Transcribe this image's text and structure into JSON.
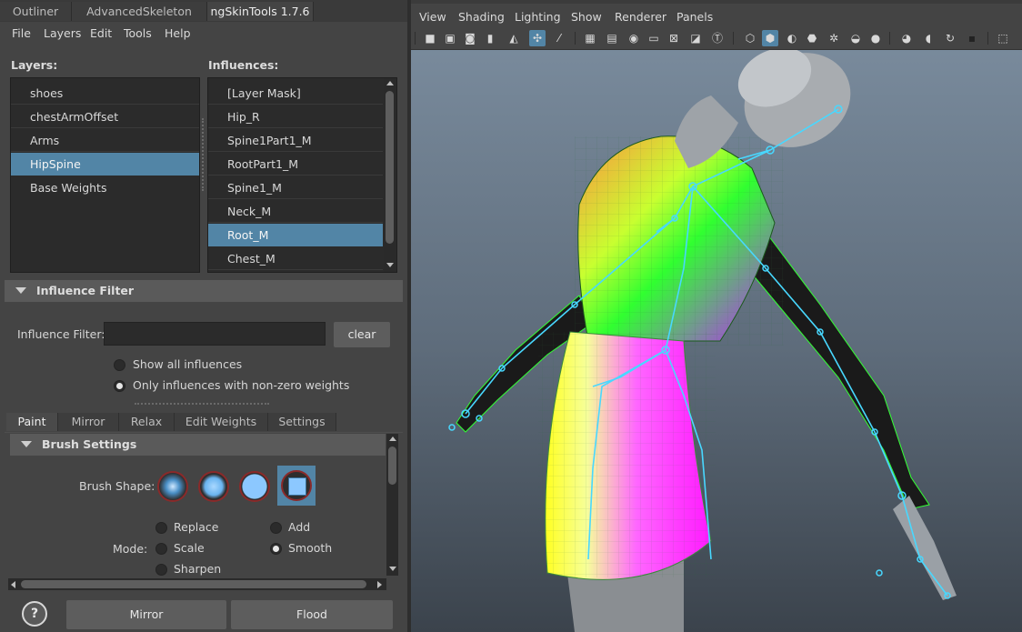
{
  "top_tabs": [
    "Outliner",
    "AdvancedSkeleton",
    "ngSkinTools 1.7.6"
  ],
  "menu": [
    "File",
    "Layers",
    "Edit",
    "Tools",
    "Help"
  ],
  "layers": {
    "label": "Layers:",
    "items": [
      "shoes",
      "chestArmOffset",
      "Arms",
      "HipSpine",
      "Base Weights"
    ],
    "selected": "HipSpine"
  },
  "influences": {
    "label": "Influences:",
    "items": [
      "[Layer Mask]",
      "Hip_R",
      "Spine1Part1_M",
      "RootPart1_M",
      "Spine1_M",
      "Neck_M",
      "Root_M",
      "Chest_M"
    ],
    "selected": "Root_M"
  },
  "influence_filter": {
    "header": "Influence Filter",
    "label": "Influence Filter:",
    "value": "",
    "clear_label": "clear",
    "options": [
      "Show all influences",
      "Only influences with non-zero weights"
    ],
    "selected_option": "Only influences with non-zero weights"
  },
  "sub_tabs": [
    "Paint",
    "Mirror",
    "Relax",
    "Edit Weights",
    "Settings"
  ],
  "active_sub_tab": "Paint",
  "brush_settings": {
    "header": "Brush Settings",
    "shape_label": "Brush Shape:",
    "shape_icons": [
      "soft-brush-icon",
      "medium-brush-icon",
      "solid-brush-icon",
      "square-brush-icon"
    ],
    "mode_label": "Mode:",
    "modes": [
      "Replace",
      "Add",
      "Scale",
      "Smooth",
      "Sharpen"
    ],
    "selected_mode": "Smooth"
  },
  "bottom_buttons": {
    "help": "?",
    "mirror": "Mirror",
    "flood": "Flood"
  },
  "viewport": {
    "menu": [
      "View",
      "Shading",
      "Lighting",
      "Show",
      "Renderer",
      "Panels"
    ],
    "toolbar_icons": [
      "camera-icon",
      "camera-attr-icon",
      "bookmark-icon",
      "image-plane-icon",
      "snap-icon",
      "grid-icon",
      "film-gate-icon",
      "resolution-gate-icon",
      "gate-mask-icon",
      "field-chart-icon",
      "safe-action-icon",
      "wireframe-icon",
      "smooth-shade-icon",
      "flat-shade-icon",
      "textured-icon",
      "lights-icon",
      "shadows-icon",
      "ambient-occlusion-icon",
      "motion-blur-icon",
      "isolate-icon",
      "xray-icon"
    ]
  },
  "colors": {
    "accent": "#5285a6",
    "panel": "#444444",
    "list_bg": "#2b2b2b"
  }
}
